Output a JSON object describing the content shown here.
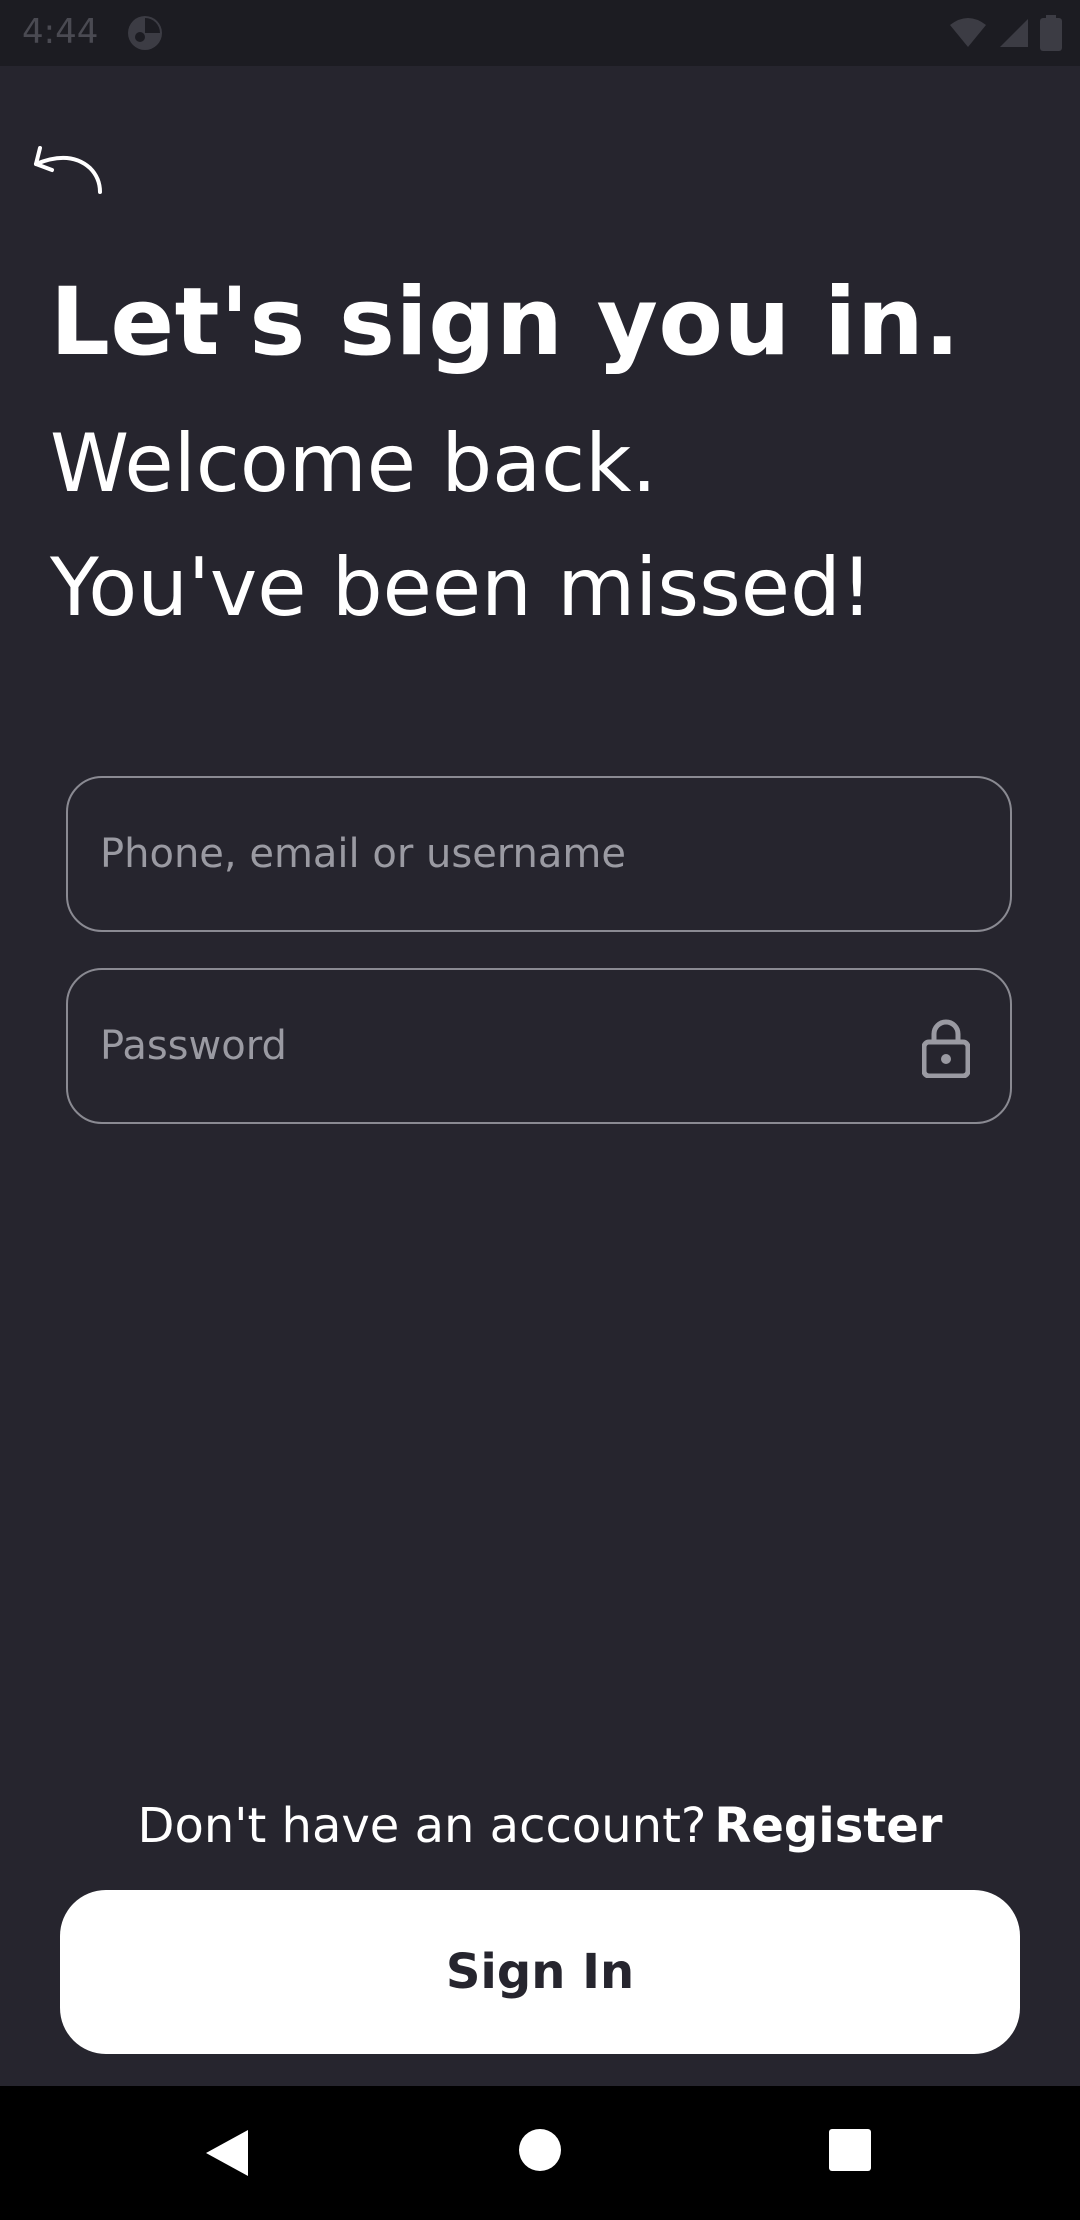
{
  "status_bar": {
    "time": "4:44",
    "icons": [
      "app-notification-icon",
      "wifi-icon",
      "signal-icon",
      "battery-icon"
    ]
  },
  "header": {
    "back_icon": "undo-arrow-icon"
  },
  "main": {
    "title": "Let's sign you in.",
    "subtitle_line1": "Welcome back.",
    "subtitle_line2": "You've been missed!"
  },
  "form": {
    "login_field": {
      "placeholder": "Phone, email or username",
      "value": ""
    },
    "password_field": {
      "placeholder": "Password",
      "value": "",
      "icon": "lock-icon"
    }
  },
  "footer": {
    "register_prompt": "Don't have an account?",
    "register_link": "Register",
    "signin_label": "Sign In"
  },
  "nav_bar": {
    "icons": [
      "back-triangle-icon",
      "home-circle-icon",
      "recents-square-icon"
    ]
  },
  "colors": {
    "background": "#26252e",
    "status_bar": "#1c1c22",
    "field_border": "#8a8a92",
    "placeholder": "#9a9aa2",
    "button_bg": "#ffffff",
    "button_text": "#26252e",
    "nav_bar": "#000000"
  }
}
